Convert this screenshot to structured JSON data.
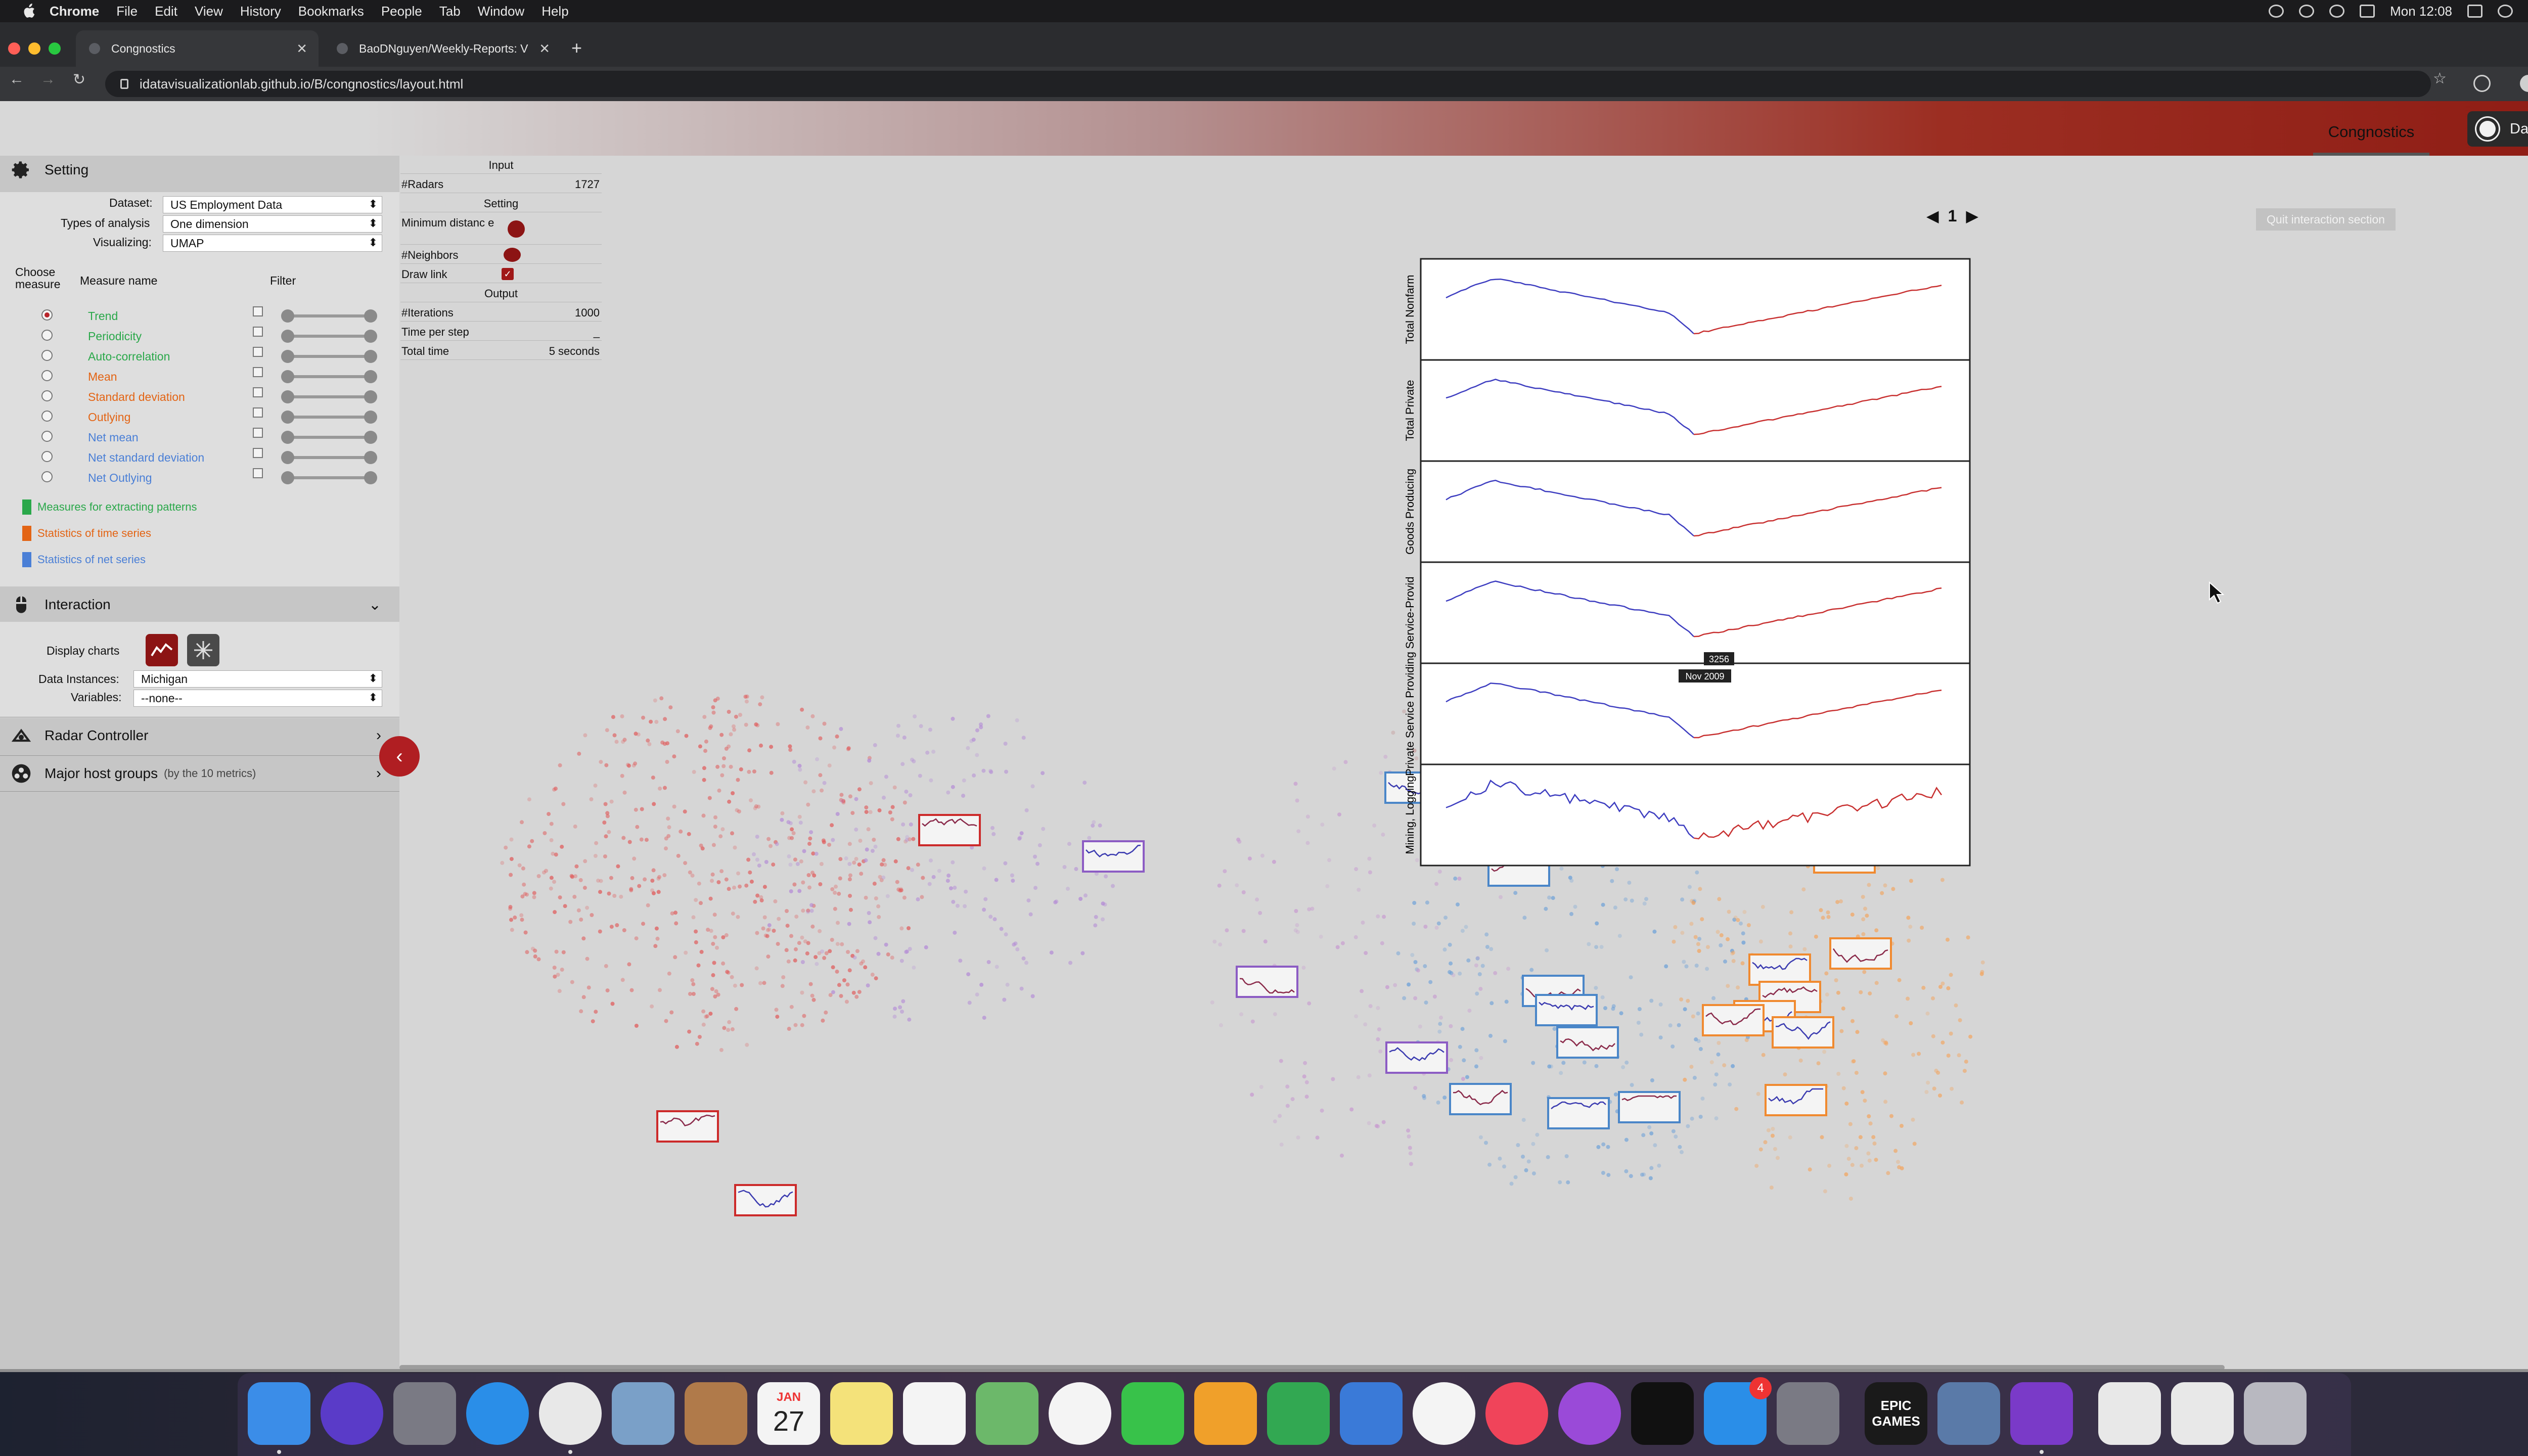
{
  "menubar": {
    "items": [
      "Chrome",
      "File",
      "Edit",
      "View",
      "History",
      "Bookmarks",
      "People",
      "Tab",
      "Window",
      "Help"
    ],
    "clock": "Mon 12:08"
  },
  "browser": {
    "tabs": [
      {
        "title": "Congnostics",
        "active": true
      },
      {
        "title": "BaoDNguyen/Weekly-Reports: V",
        "active": false
      }
    ],
    "url": "idatavisualizationlab.github.io/B/congnostics/layout.html"
  },
  "header": {
    "brand": "Congnostics",
    "dark_label": "Dark"
  },
  "setting": {
    "title": "Setting",
    "dataset_label": "Dataset:",
    "dataset_value": "US Employment Data",
    "analysis_label": "Types of analysis",
    "analysis_value": "One dimension",
    "visualizing_label": "Visualizing:",
    "visualizing_value": "UMAP",
    "col_choose": "Choose measure",
    "col_name": "Measure name",
    "col_filter": "Filter",
    "measures": [
      {
        "name": "Trend",
        "color": "#2aa84a",
        "selected": true
      },
      {
        "name": "Periodicity",
        "color": "#2aa84a",
        "selected": false
      },
      {
        "name": "Auto-correlation",
        "color": "#2aa84a",
        "selected": false
      },
      {
        "name": "Mean",
        "color": "#e36414",
        "selected": false
      },
      {
        "name": "Standard deviation",
        "color": "#e36414",
        "selected": false
      },
      {
        "name": "Outlying",
        "color": "#e36414",
        "selected": false
      },
      {
        "name": "Net mean",
        "color": "#4a7fd6",
        "selected": false
      },
      {
        "name": "Net standard deviation",
        "color": "#4a7fd6",
        "selected": false
      },
      {
        "name": "Net Outlying",
        "color": "#4a7fd6",
        "selected": false
      }
    ],
    "legend": [
      {
        "label": "Measures for extracting patterns",
        "color": "#2aa84a"
      },
      {
        "label": "Statistics of time series",
        "color": "#e36414"
      },
      {
        "label": "Statistics of net series",
        "color": "#4a7fd6"
      }
    ]
  },
  "interaction": {
    "title": "Interaction",
    "display_label": "Display charts",
    "instances_label": "Data Instances:",
    "instances_value": "Michigan",
    "variables_label": "Variables:",
    "variables_value": "--none--"
  },
  "radar_controller": {
    "title": "Radar Controller"
  },
  "major_groups": {
    "title": "Major host groups",
    "subtitle": "(by the 10 metrics)"
  },
  "info": {
    "input_title": "Input",
    "radars_label": "#Radars",
    "radars_value": "1727",
    "setting_title": "Setting",
    "min_dist_label": "Minimum distanc e",
    "neighbors_label": "#Neighbors",
    "draw_link_label": "Draw link",
    "output_title": "Output",
    "iterations_label": "#Iterations",
    "iterations_value": "1000",
    "time_step_label": "Time per step",
    "time_step_value": "_",
    "total_time_label": "Total time",
    "total_time_value": "5 seconds"
  },
  "detail": {
    "page": "1",
    "quit_label": "Quit interaction section",
    "rows": [
      "Total Nonfarm",
      "Total Private",
      "Goods Producing",
      "Service-Provid",
      "Private Service Providing",
      "Mining, Logging"
    ],
    "tooltip_value": "3256",
    "tooltip_date": "Nov 2009"
  },
  "dock": {
    "calendar_month": "JAN",
    "calendar_day": "27",
    "appstore_badge": "4",
    "epic_label": "EPIC GAMES"
  }
}
